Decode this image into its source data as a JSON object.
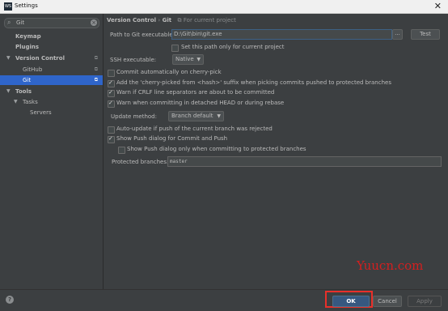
{
  "window": {
    "title": "Settings",
    "app_icon": "WS"
  },
  "sidebar": {
    "search_value": "Git",
    "items": [
      {
        "label": "Keymap"
      },
      {
        "label": "Plugins"
      },
      {
        "label": "Version Control"
      },
      {
        "label": "GitHub"
      },
      {
        "label": "Git"
      },
      {
        "label": "Tools"
      },
      {
        "label": "Tasks"
      },
      {
        "label": "Servers"
      }
    ],
    "project_icon": "⧉"
  },
  "breadcrumb": {
    "parent": "Version Control",
    "separator": "›",
    "current": "Git",
    "scope": "For current project"
  },
  "form": {
    "path_label": "Path to Git executable:",
    "path_value": "D:\\Git\\bin\\git.exe",
    "browse_label": "...",
    "test_label": "Test",
    "set_path_only_label": "Set this path only for current project",
    "ssh_label": "SSH executable:",
    "ssh_value": "Native",
    "commit_cherry_label": "Commit automatically on cherry-pick",
    "add_cherry_label": "Add the 'cherry-picked from <hash>' suffix when picking commits pushed to protected branches",
    "warn_crlf_label": "Warn if CRLF line separators are about to be committed",
    "warn_detached_label": "Warn when committing in detached HEAD or during rebase",
    "update_method_label": "Update method:",
    "update_method_value": "Branch default",
    "auto_update_label": "Auto-update if push of the current branch was rejected",
    "show_push_label": "Show Push dialog for Commit and Push",
    "show_push_protected_label": "Show Push dialog only when committing to protected branches",
    "protected_label": "Protected branches:",
    "protected_value": "master"
  },
  "watermark": "Yuucn.com",
  "buttons": {
    "ok": "OK",
    "cancel": "Cancel",
    "apply": "Apply",
    "help": "?"
  },
  "colors": {
    "accent": "#365880",
    "selected": "#2f65ca",
    "highlight": "#e8302a"
  }
}
